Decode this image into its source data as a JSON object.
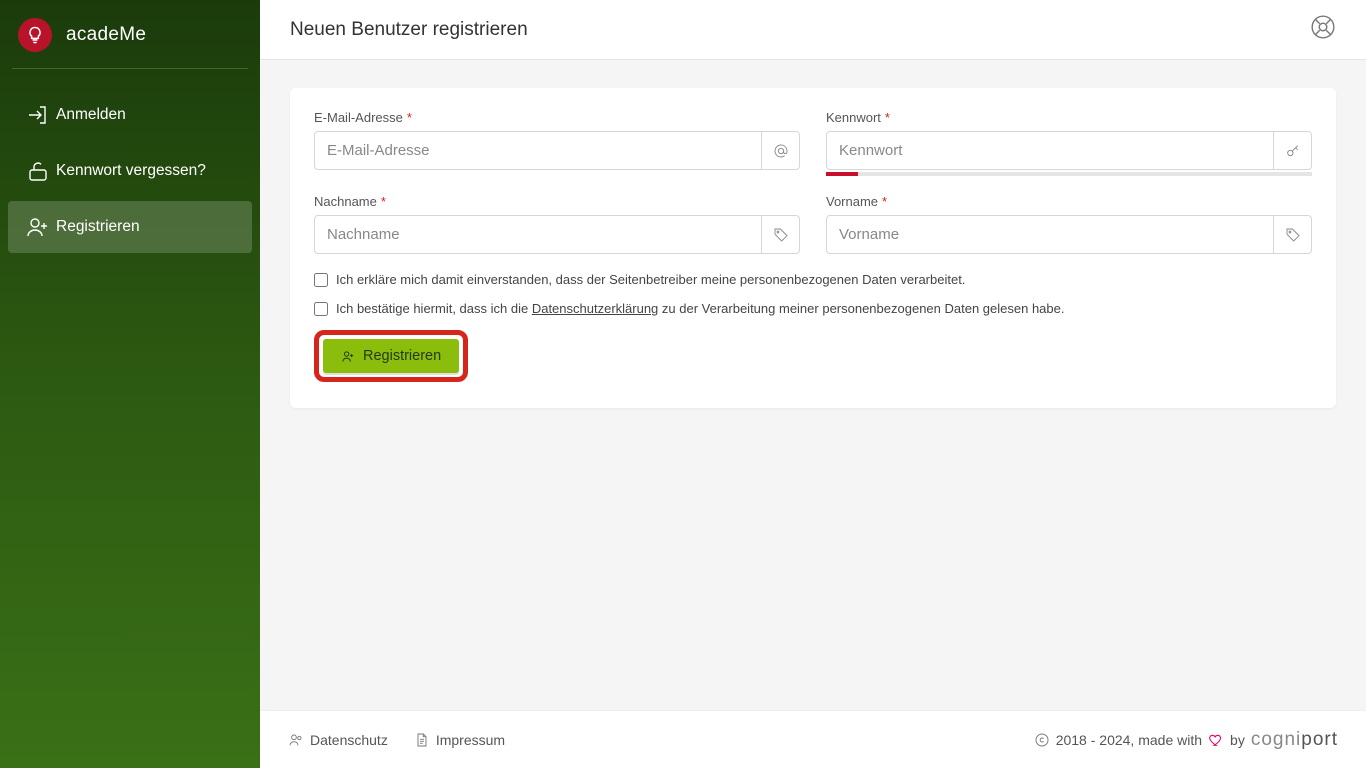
{
  "brand": {
    "name": "acadeMe"
  },
  "sidebar": {
    "items": [
      {
        "label": "Anmelden"
      },
      {
        "label": "Kennwort vergessen?"
      },
      {
        "label": "Registrieren"
      }
    ]
  },
  "header": {
    "title": "Neuen Benutzer registrieren"
  },
  "form": {
    "email": {
      "label": "E-Mail-Adresse",
      "placeholder": "E-Mail-Adresse"
    },
    "password": {
      "label": "Kennwort",
      "placeholder": "Kennwort"
    },
    "lastname": {
      "label": "Nachname",
      "placeholder": "Nachname"
    },
    "firstname": {
      "label": "Vorname",
      "placeholder": "Vorname"
    },
    "consent1": "Ich erkläre mich damit einverstanden, dass der Seitenbetreiber meine personenbezogenen Daten verarbeitet.",
    "consent2_pre": "Ich bestätige hiermit, dass ich die ",
    "consent2_link": "Datenschutzerklärung",
    "consent2_post": " zu der Verarbeitung meiner personenbezogenen Daten gelesen habe.",
    "submit": "Registrieren"
  },
  "footer": {
    "privacy": "Datenschutz",
    "imprint": "Impressum",
    "copyright": "2018 - 2024, made with",
    "by": "by",
    "brand_a": "cogni",
    "brand_b": "port"
  }
}
